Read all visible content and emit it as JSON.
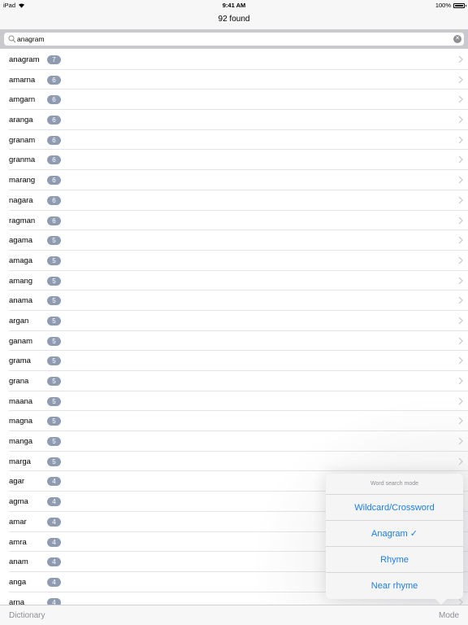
{
  "status_bar": {
    "device": "iPad",
    "time": "9:41 AM",
    "battery": "100%"
  },
  "nav": {
    "title": "92 found"
  },
  "search": {
    "value": "anagram",
    "placeholder": ""
  },
  "results": [
    {
      "word": "anagram",
      "count": "7"
    },
    {
      "word": "amarna",
      "count": "6"
    },
    {
      "word": "amgarn",
      "count": "6"
    },
    {
      "word": "aranga",
      "count": "6"
    },
    {
      "word": "granam",
      "count": "6"
    },
    {
      "word": "granma",
      "count": "6"
    },
    {
      "word": "marang",
      "count": "6"
    },
    {
      "word": "nagara",
      "count": "6"
    },
    {
      "word": "ragman",
      "count": "6"
    },
    {
      "word": "agama",
      "count": "5"
    },
    {
      "word": "amaga",
      "count": "5"
    },
    {
      "word": "amang",
      "count": "5"
    },
    {
      "word": "anama",
      "count": "5"
    },
    {
      "word": "argan",
      "count": "5"
    },
    {
      "word": "ganam",
      "count": "5"
    },
    {
      "word": "grama",
      "count": "5"
    },
    {
      "word": "grana",
      "count": "5"
    },
    {
      "word": "maana",
      "count": "5"
    },
    {
      "word": "magna",
      "count": "5"
    },
    {
      "word": "manga",
      "count": "5"
    },
    {
      "word": "marga",
      "count": "5"
    },
    {
      "word": "agar",
      "count": "4"
    },
    {
      "word": "agma",
      "count": "4"
    },
    {
      "word": "amar",
      "count": "4"
    },
    {
      "word": "amra",
      "count": "4"
    },
    {
      "word": "anam",
      "count": "4"
    },
    {
      "word": "anga",
      "count": "4"
    },
    {
      "word": "arna",
      "count": "4"
    }
  ],
  "popover": {
    "header": "Word search mode",
    "options": [
      {
        "label": "Wildcard/Crossword"
      },
      {
        "label": "Anagram ✓"
      },
      {
        "label": "Rhyme"
      },
      {
        "label": "Near rhyme"
      }
    ]
  },
  "toolbar": {
    "dictionary_label": "Dictionary",
    "mode_label": "Mode"
  },
  "colors": {
    "accent": "#1a7ee6",
    "badge": "#8e9bb0",
    "muted": "#8e8e93"
  }
}
